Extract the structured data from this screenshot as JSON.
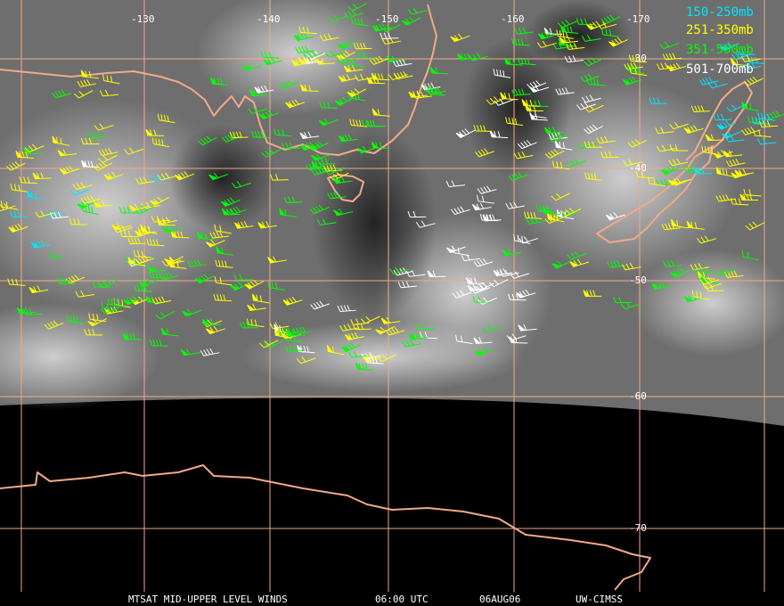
{
  "map": {
    "lon_labels": [
      "-130",
      "-140",
      "-150",
      "-160",
      "-170"
    ],
    "lat_labels": [
      "-30",
      "-40",
      "-50",
      "-60",
      "-70"
    ],
    "grid_color": "#f2a98a",
    "coast_color": "#f2a98a",
    "background_color": "#000000",
    "imagery": "water-vapor"
  },
  "legend": {
    "entries": [
      {
        "label": "150-250mb",
        "color": "#00e5ff"
      },
      {
        "label": "251-350mb",
        "color": "#ffff00"
      },
      {
        "label": "351-500mb",
        "color": "#00ff00"
      },
      {
        "label": "501-700mb",
        "color": "#ffffff"
      }
    ]
  },
  "footer": {
    "product": "MTSAT MID-UPPER LEVEL WINDS",
    "time": "06:00 UTC",
    "date": "06AUG06",
    "source": "UW-CIMSS"
  }
}
